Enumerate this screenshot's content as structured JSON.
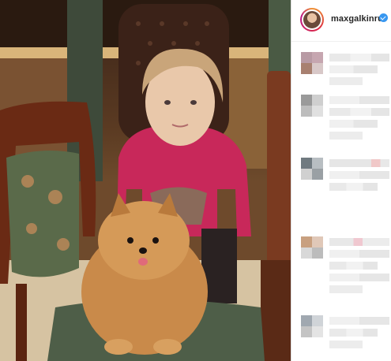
{
  "post": {
    "username": "maxgalkinru",
    "verified": true
  },
  "icons": {
    "avatar": "profile-avatar-icon",
    "verified": "verified-badge-icon"
  },
  "colors": {
    "story_ring": [
      "#f09433",
      "#dc2743",
      "#bc1888"
    ],
    "verified_blue": "#3897f0",
    "username": "#262626"
  }
}
